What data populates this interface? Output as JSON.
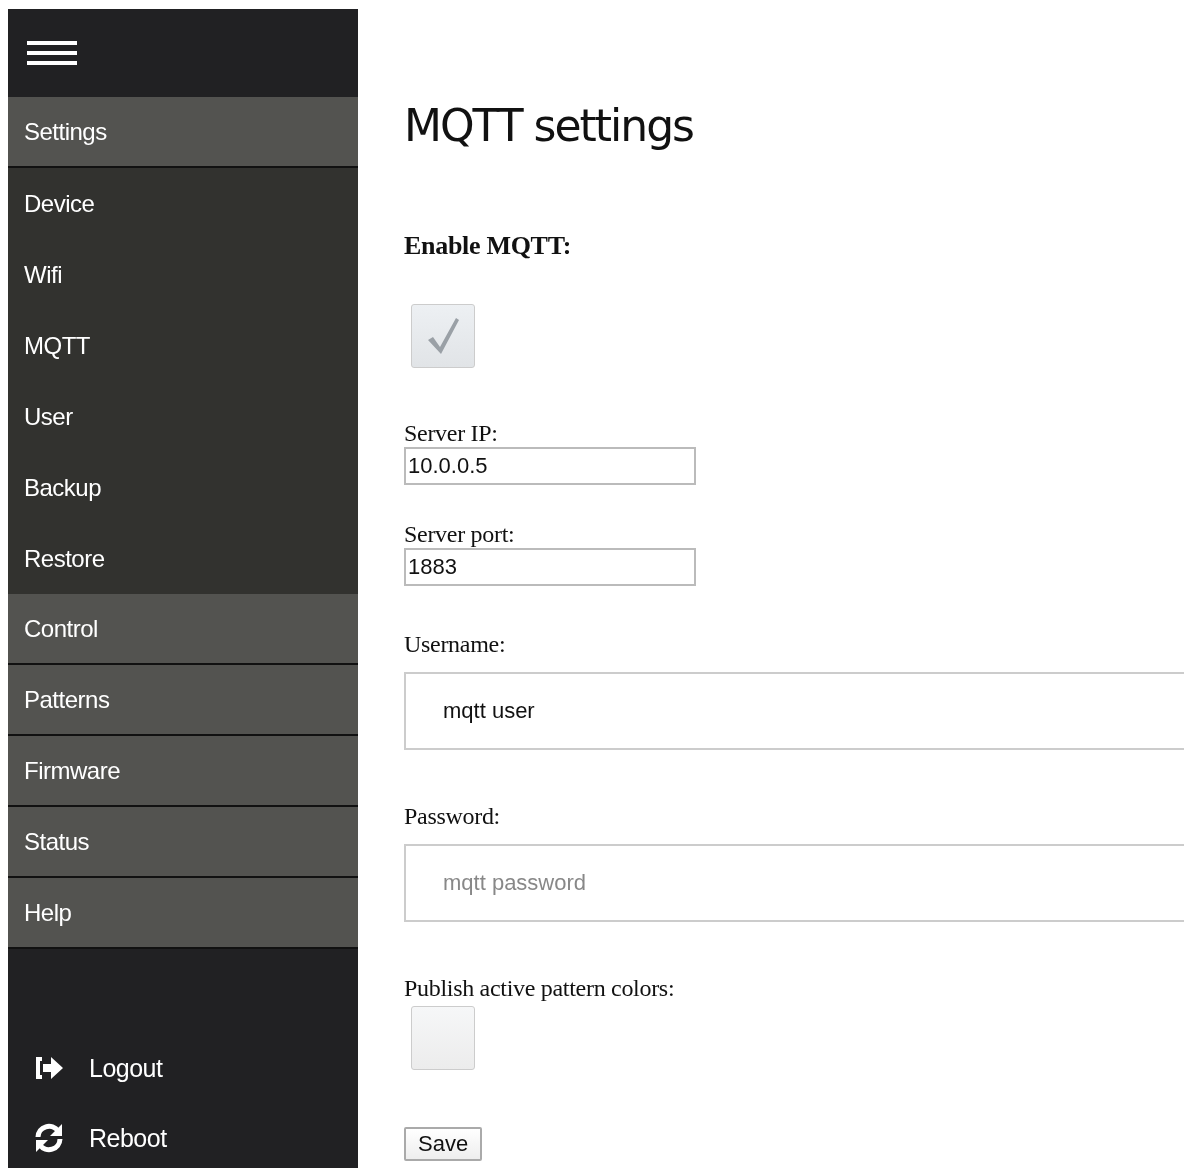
{
  "sidebar": {
    "items": [
      {
        "label": "Settings",
        "kind": "group"
      },
      {
        "label": "Device",
        "kind": "sub"
      },
      {
        "label": "Wifi",
        "kind": "sub"
      },
      {
        "label": "MQTT",
        "kind": "sub"
      },
      {
        "label": "User",
        "kind": "sub"
      },
      {
        "label": "Backup",
        "kind": "sub"
      },
      {
        "label": "Restore",
        "kind": "sub"
      },
      {
        "label": "Control",
        "kind": "group"
      },
      {
        "label": "Patterns",
        "kind": "group"
      },
      {
        "label": "Firmware",
        "kind": "group"
      },
      {
        "label": "Status",
        "kind": "group"
      },
      {
        "label": "Help",
        "kind": "group"
      }
    ],
    "footer": [
      {
        "label": "Logout"
      },
      {
        "label": "Reboot"
      }
    ]
  },
  "main": {
    "title": "MQTT settings",
    "fields": [
      {
        "kind": "checkbox",
        "label": "Enable MQTT:",
        "checked": true
      },
      {
        "kind": "short",
        "label": "Server IP:",
        "value": "10.0.0.5"
      },
      {
        "kind": "short",
        "label": "Server port:",
        "value": "1883"
      },
      {
        "kind": "wide",
        "label": "Username:",
        "value": "mqtt user"
      },
      {
        "kind": "wide",
        "label": "Password:",
        "placeholder": "mqtt password"
      },
      {
        "kind": "checkbox-small",
        "label": "Publish active pattern colors:",
        "checked": false
      }
    ],
    "save_button": "Save"
  }
}
